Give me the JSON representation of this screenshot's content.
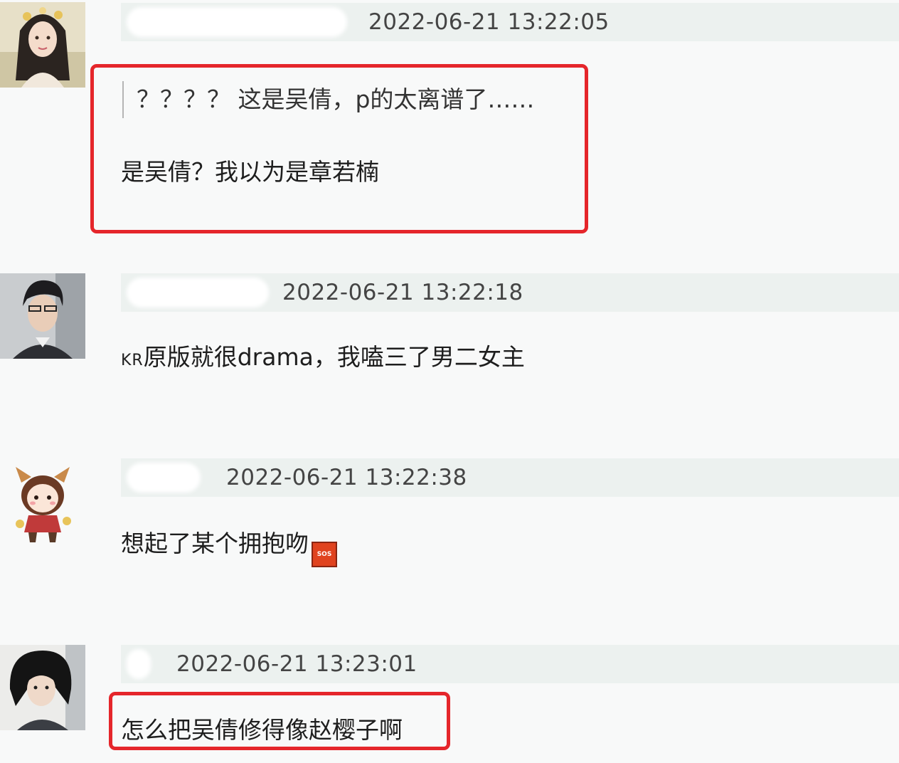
{
  "comments": [
    {
      "timestamp": "2022-06-21 13:22:05",
      "quote": "？？？？ 这是吴倩，p的太离谱了……",
      "text": "是吴倩？我以为是章若楠",
      "highlighted": true
    },
    {
      "timestamp": "2022-06-21 13:22:18",
      "prefix": "KR",
      "text": "原版就很drama，我嗑三了男二女主",
      "highlighted": false
    },
    {
      "timestamp": "2022-06-21 13:22:38",
      "text": "想起了某个拥抱吻",
      "emoji": "SOS",
      "emoji_icon": "sos-emoji-icon",
      "highlighted": false
    },
    {
      "timestamp": "2022-06-21 13:23:01",
      "text": "怎么把吴倩修得像赵樱子啊",
      "highlighted": true
    }
  ],
  "colors": {
    "background": "#f8f9f9",
    "meta_bar": "#ecf1ef",
    "highlight_border": "#e5262b",
    "emoji_bg": "#e0431f"
  }
}
